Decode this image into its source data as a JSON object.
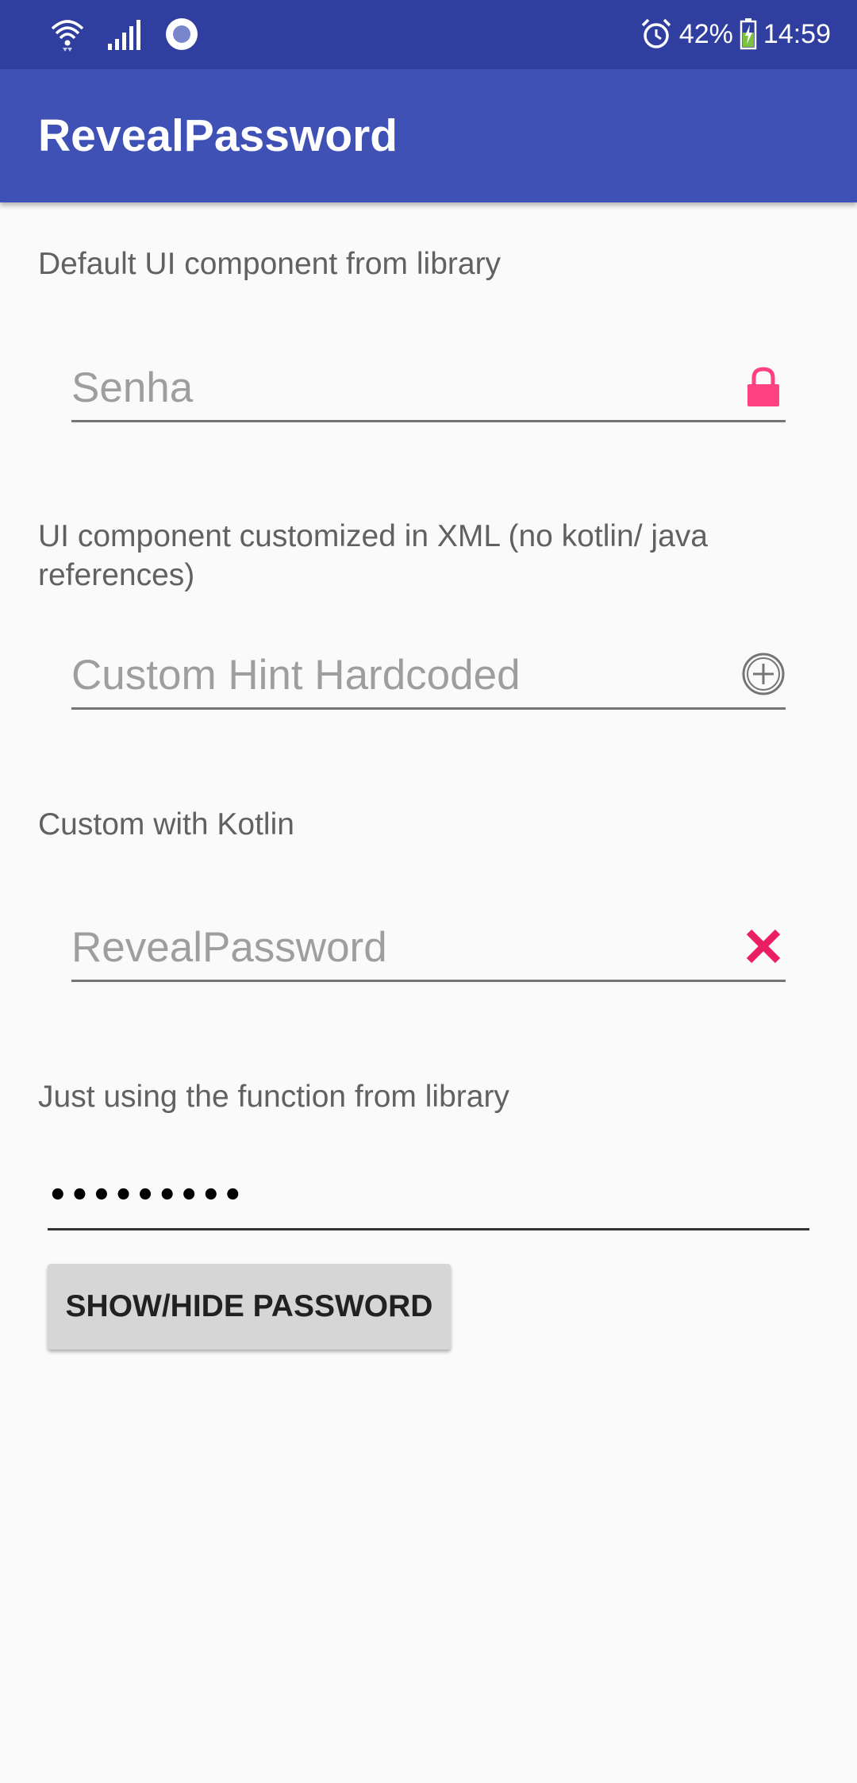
{
  "status_bar": {
    "battery_percent": "42%",
    "time": "14:59",
    "icons": [
      "wifi-icon",
      "signal-icon",
      "data-sync-icon",
      "alarm-icon",
      "battery-charging-icon"
    ]
  },
  "app_bar": {
    "title": "RevealPassword"
  },
  "sections": {
    "default": {
      "label": "Default UI component from library",
      "hint": "Senha",
      "icon": "lock-icon",
      "icon_color": "#ff4081"
    },
    "xml": {
      "label": "UI component customized in XML (no kotlin/ java references)",
      "hint": "Custom Hint Hardcoded",
      "icon": "circle-plus-icon",
      "icon_color": "#757575"
    },
    "kotlin": {
      "label": "Custom with Kotlin",
      "hint": "RevealPassword",
      "icon": "close-icon",
      "icon_color": "#e91e63"
    },
    "function": {
      "label": "Just using the function from library",
      "masked_value": "•••••••••",
      "button_label": "SHOW/HIDE PASSWORD"
    }
  },
  "colors": {
    "status_bar": "#303f9f",
    "app_bar": "#3f51b5",
    "accent": "#ff4081",
    "background": "#fafafa"
  }
}
